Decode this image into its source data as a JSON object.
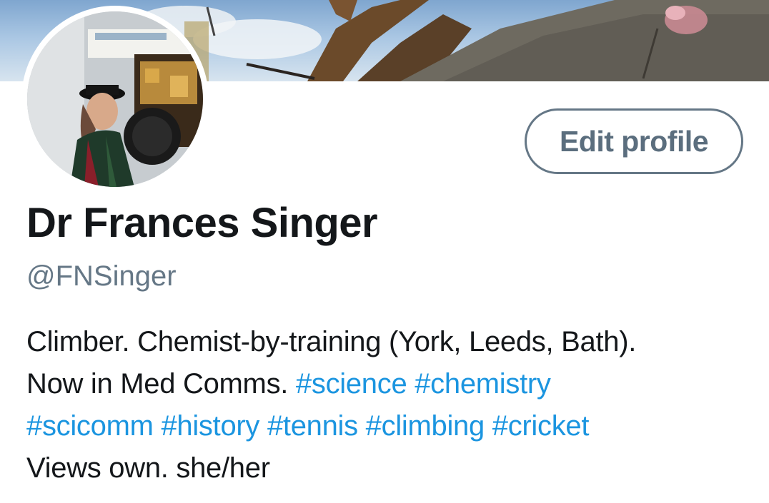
{
  "profile": {
    "display_name": "Dr Frances Singer",
    "handle": "@FNSinger",
    "edit_button_label": "Edit profile",
    "bio": {
      "line1_text": "Climber. Chemist-by-training (York, Leeds, Bath).",
      "line2_text": "Now in Med Comms.",
      "line2_tags": [
        "#science",
        "#chemistry"
      ],
      "line3_tags": [
        "#scicomm",
        "#history",
        "#tennis",
        "#climbing",
        "#cricket"
      ],
      "line4_text": "Views own. she/her"
    }
  },
  "colors": {
    "text_primary": "#14171a",
    "text_secondary": "#657786",
    "hashtag_link": "#1b95e0",
    "button_border": "#657786"
  }
}
